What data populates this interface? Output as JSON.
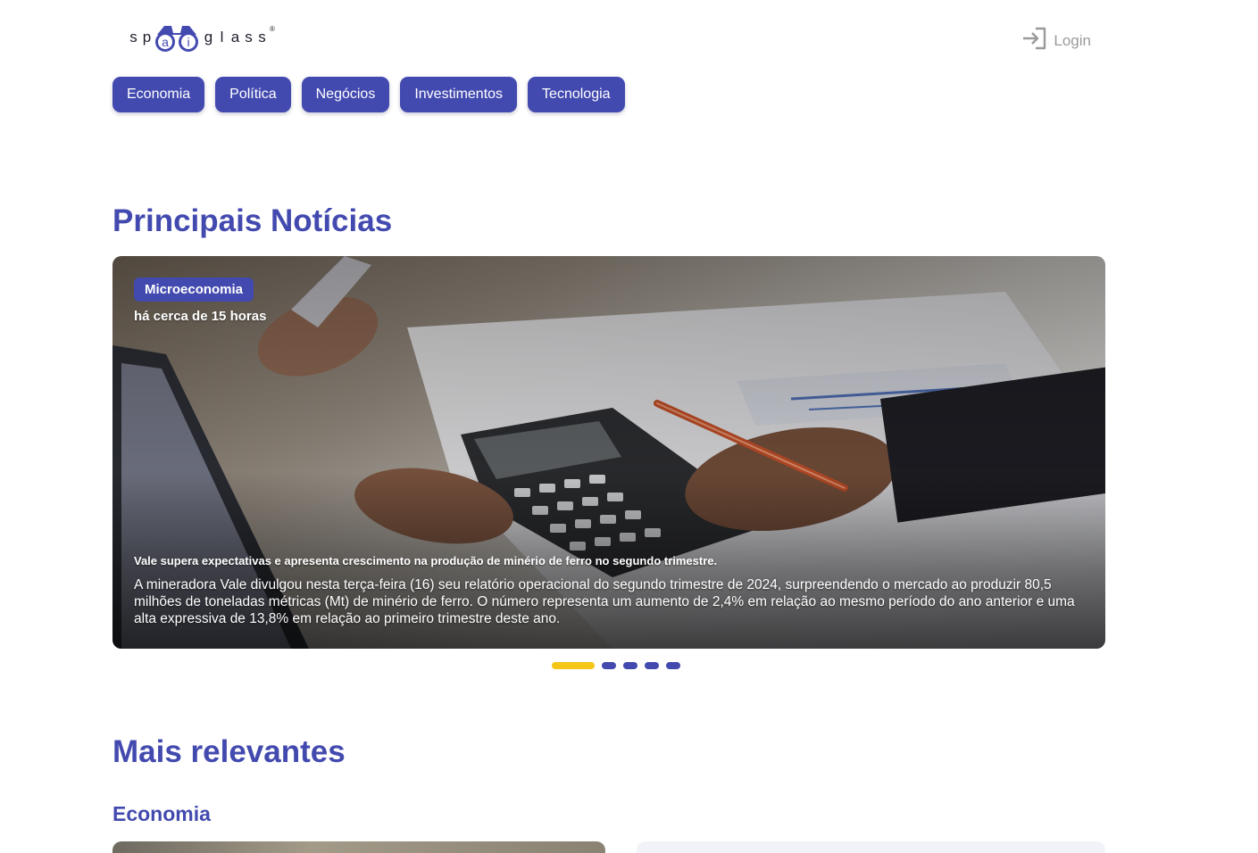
{
  "header": {
    "logo_text": "spaiglass",
    "logo_letters_left": [
      "s",
      "p"
    ],
    "logo_letters_lens": [
      "a",
      "i"
    ],
    "logo_letters_right": [
      "g",
      "l",
      "a",
      "s",
      "s"
    ],
    "logo_reg": "®",
    "login_label": "Login",
    "login_icon": "login-arrow-icon"
  },
  "nav": {
    "items": [
      {
        "label": "Economia"
      },
      {
        "label": "Política"
      },
      {
        "label": "Negócios"
      },
      {
        "label": "Investimentos"
      },
      {
        "label": "Tecnologia"
      }
    ]
  },
  "principais": {
    "title": "Principais Notícias",
    "slide": {
      "category": "Microeconomia",
      "time": "há cerca de 15 horas",
      "headline": "Vale supera expectativas e apresenta crescimento na produção de minério de ferro no segundo trimestre.",
      "summary": "A mineradora Vale divulgou nesta terça-feira (16) seu relatório operacional do segundo trimestre de 2024, surpreendendo o mercado ao produzir 80,5 milhões de toneladas métricas (Mt) de minério de ferro. O número representa um aumento de 2,4% em relação ao mesmo período do ano anterior e uma alta expressiva de 13,8% em relação ao primeiro trimestre deste ano."
    },
    "dots": {
      "count": 5,
      "active_index": 0
    }
  },
  "relevantes": {
    "title": "Mais relevantes",
    "subsection": "Economia"
  },
  "colors": {
    "brand": "#434aaf",
    "active_dot": "#f5c518",
    "login_gray": "#9a9a9a"
  }
}
